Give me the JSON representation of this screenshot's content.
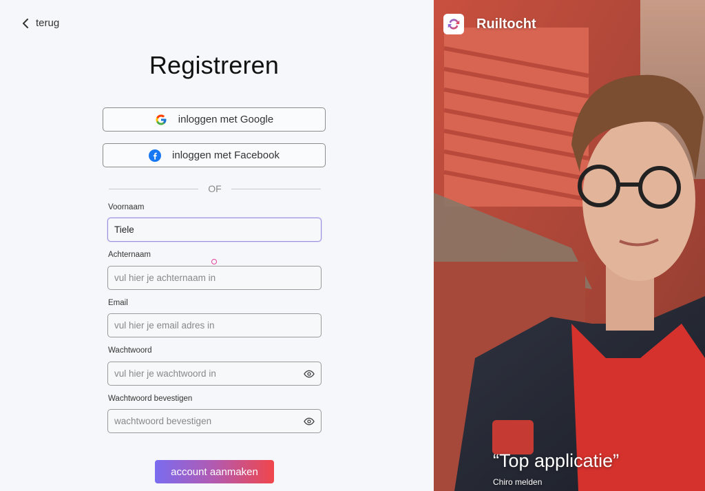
{
  "nav": {
    "back_label": "terug"
  },
  "page": {
    "title": "Registreren"
  },
  "social": {
    "google_label": "inloggen met Google",
    "facebook_label": "inloggen met Facebook"
  },
  "divider_label": "OF",
  "form": {
    "first_name": {
      "label": "Voornaam",
      "value": "Tiele",
      "placeholder": ""
    },
    "last_name": {
      "label": "Achternaam",
      "value": "",
      "placeholder": "vul hier je achternaam in"
    },
    "email": {
      "label": "Email",
      "value": "",
      "placeholder": "vul hier je email adres in"
    },
    "password": {
      "label": "Wachtwoord",
      "value": "",
      "placeholder": "vul hier je wachtwoord in"
    },
    "password_confirm": {
      "label": "Wachtwoord bevestigen",
      "value": "",
      "placeholder": "wachtwoord bevestigen"
    },
    "submit_label": "account aanmaken"
  },
  "brand": {
    "name": "Ruiltocht"
  },
  "testimonial": {
    "quote": "“Top applicatie”",
    "author": "Chiro melden"
  },
  "colors": {
    "gradient_start": "#7a6cf0",
    "gradient_end": "#f0464b",
    "focus_border": "#9a8fe0",
    "facebook_blue": "#1877f2"
  },
  "icons": [
    "chevron-left-icon",
    "google-icon",
    "facebook-icon",
    "eye-icon",
    "ruiltocht-logo-icon"
  ]
}
